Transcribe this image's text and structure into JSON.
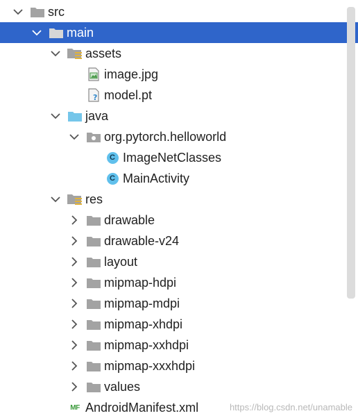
{
  "tree": {
    "nodes": [
      {
        "label": "src",
        "icon": "folder-icon",
        "state": "expanded"
      },
      {
        "label": "main",
        "icon": "folder-icon",
        "state": "expanded",
        "selected": true
      },
      {
        "label": "assets",
        "icon": "resource-folder-icon",
        "state": "expanded"
      },
      {
        "label": "image.jpg",
        "icon": "image-file-icon",
        "state": "leaf"
      },
      {
        "label": "model.pt",
        "icon": "unknown-file-icon",
        "state": "leaf"
      },
      {
        "label": "java",
        "icon": "source-folder-icon",
        "state": "expanded"
      },
      {
        "label": "org.pytorch.helloworld",
        "icon": "package-icon",
        "state": "expanded"
      },
      {
        "label": "ImageNetClasses",
        "icon": "class-icon",
        "state": "leaf"
      },
      {
        "label": "MainActivity",
        "icon": "class-icon",
        "state": "leaf"
      },
      {
        "label": "res",
        "icon": "resource-folder-icon",
        "state": "expanded"
      },
      {
        "label": "drawable",
        "icon": "folder-icon",
        "state": "collapsed"
      },
      {
        "label": "drawable-v24",
        "icon": "folder-icon",
        "state": "collapsed"
      },
      {
        "label": "layout",
        "icon": "folder-icon",
        "state": "collapsed"
      },
      {
        "label": "mipmap-hdpi",
        "icon": "folder-icon",
        "state": "collapsed"
      },
      {
        "label": "mipmap-mdpi",
        "icon": "folder-icon",
        "state": "collapsed"
      },
      {
        "label": "mipmap-xhdpi",
        "icon": "folder-icon",
        "state": "collapsed"
      },
      {
        "label": "mipmap-xxhdpi",
        "icon": "folder-icon",
        "state": "collapsed"
      },
      {
        "label": "mipmap-xxxhdpi",
        "icon": "folder-icon",
        "state": "collapsed"
      },
      {
        "label": "values",
        "icon": "folder-icon",
        "state": "collapsed"
      },
      {
        "label": "AndroidManifest.xml",
        "icon": "manifest-file-icon",
        "state": "leaf"
      }
    ]
  },
  "class_icon_letter": "C",
  "manifest_icon_text": "MF",
  "watermark": "https://blog.csdn.net/unamable",
  "colors": {
    "selection": "#2f65ca",
    "folder": "#a3a3a3",
    "java_folder": "#75c6ea",
    "class_icon": "#60c0ec",
    "resource_lines": "#e2b33a"
  }
}
